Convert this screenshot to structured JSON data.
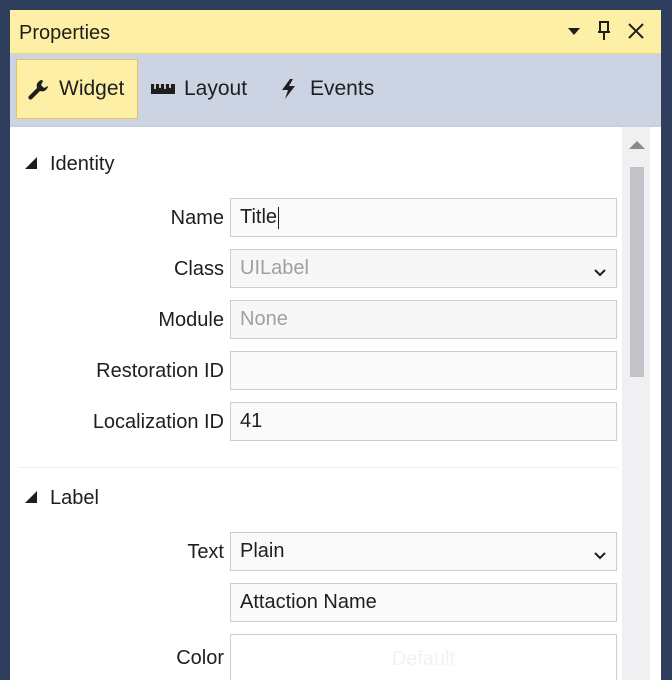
{
  "window": {
    "title": "Properties",
    "controls": [
      "dropdown-icon",
      "pin-icon",
      "close-icon"
    ]
  },
  "tabs": [
    {
      "label": "Widget",
      "icon": "wrench-icon",
      "active": true
    },
    {
      "label": "Layout",
      "icon": "ruler-icon",
      "active": false
    },
    {
      "label": "Events",
      "icon": "lightning-icon",
      "active": false
    }
  ],
  "identity": {
    "heading": "Identity",
    "name_label": "Name",
    "name_value": "Title",
    "class_label": "Class",
    "class_value": "UILabel",
    "module_label": "Module",
    "module_placeholder": "None",
    "restoration_label": "Restoration ID",
    "restoration_value": "",
    "localization_label": "Localization ID",
    "localization_value": "41"
  },
  "label_section": {
    "heading": "Label",
    "text_label": "Text",
    "text_mode": "Plain",
    "text_value": "Attaction Name",
    "color_label": "Color",
    "color_value": "Default"
  },
  "colors": {
    "title_bg": "#fdf0a6",
    "tab_active_bg": "#fdf0a6",
    "tab_bar_bg": "#ccd4e4",
    "frame_bg": "#2e3e5c"
  }
}
